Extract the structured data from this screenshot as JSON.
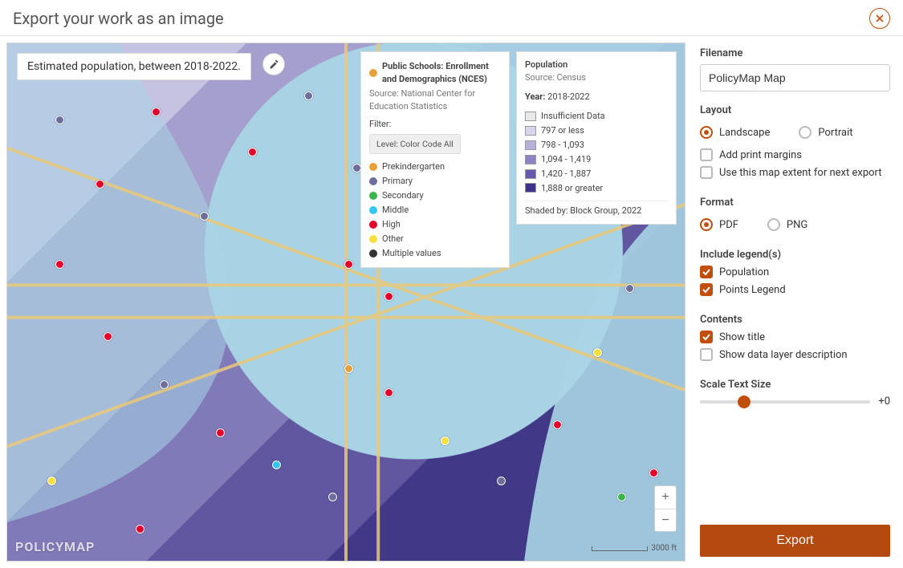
{
  "header": {
    "title": "Export your work as an image"
  },
  "map": {
    "titleBox": "Estimated population, between 2018-2022.",
    "watermark": "POLICYMAP",
    "scale": "3000 ft",
    "pointsLegend": {
      "title": "Public Schools: Enrollment and Demographics (NCES)",
      "source": "Source: National Center for Education Statistics",
      "filterLabel": "Filter:",
      "filterButton": "Level: Color Code All",
      "items": [
        {
          "label": "Prekindergarten",
          "color": "#e8a13a"
        },
        {
          "label": "Primary",
          "color": "#6e6e9e"
        },
        {
          "label": "Secondary",
          "color": "#3bb54a"
        },
        {
          "label": "Middle",
          "color": "#34c6f4"
        },
        {
          "label": "High",
          "color": "#e4002b"
        },
        {
          "label": "Other",
          "color": "#f5e03c"
        },
        {
          "label": "Multiple values",
          "color": "#333333"
        }
      ]
    },
    "popLegend": {
      "title": "Population",
      "source": "Source: Census",
      "yearLabel": "Year:",
      "year": "2018-2022",
      "shadedBy": "Shaded by: Block Group, 2022",
      "bins": [
        {
          "label": "Insufficient Data",
          "color": "#e9e9e9"
        },
        {
          "label": "797 or less",
          "color": "#d8d6ec"
        },
        {
          "label": "798 - 1,093",
          "color": "#b6b1db"
        },
        {
          "label": "1,094 - 1,419",
          "color": "#8d84c6"
        },
        {
          "label": "1,420 - 1,887",
          "color": "#655ab0"
        },
        {
          "label": "1,888 or greater",
          "color": "#3c338c"
        }
      ]
    }
  },
  "sidebar": {
    "filename": {
      "label": "Filename",
      "value": "PolicyMap Map"
    },
    "layout": {
      "label": "Layout",
      "landscape": "Landscape",
      "portrait": "Portrait",
      "margins": "Add print margins",
      "extent": "Use this map extent for next export",
      "selected": "landscape",
      "marginsChecked": false,
      "extentChecked": false
    },
    "format": {
      "label": "Format",
      "pdf": "PDF",
      "png": "PNG",
      "selected": "pdf"
    },
    "legends": {
      "label": "Include legend(s)",
      "population": "Population",
      "points": "Points Legend",
      "populationChecked": true,
      "pointsChecked": true
    },
    "contents": {
      "label": "Contents",
      "showTitle": "Show title",
      "showDesc": "Show data layer description",
      "showTitleChecked": true,
      "showDescChecked": false
    },
    "scaleText": {
      "label": "Scale Text Size",
      "value": "+0"
    },
    "exportButton": "Export"
  }
}
